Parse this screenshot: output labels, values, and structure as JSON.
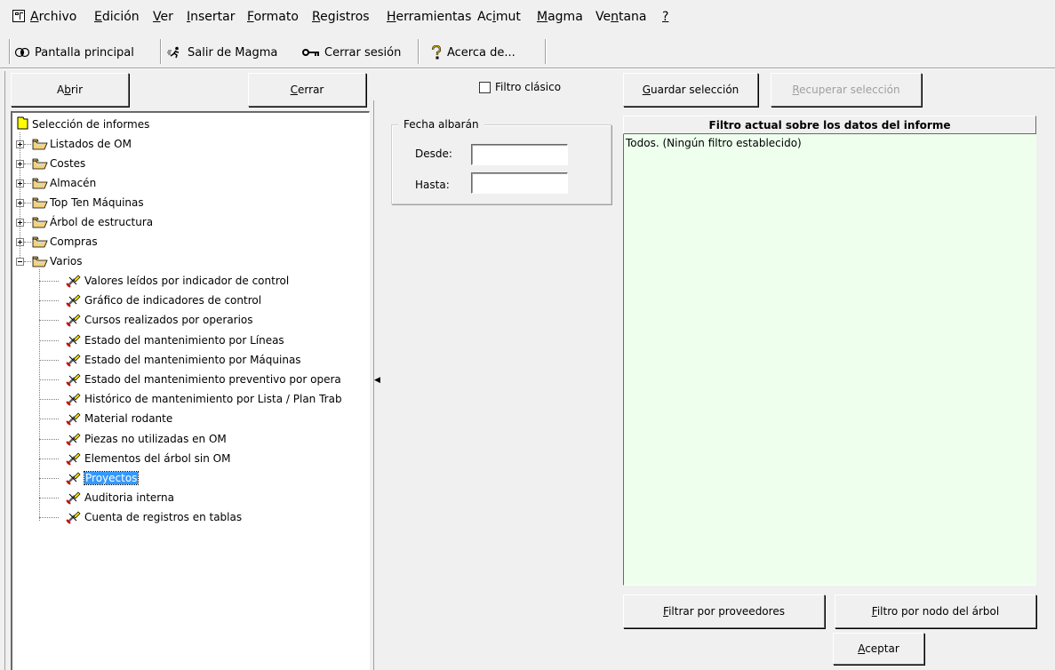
{
  "menu": {
    "items": [
      {
        "label": "Archivo",
        "key": "A"
      },
      {
        "label": "Edición",
        "key": "E"
      },
      {
        "label": "Ver",
        "key": "V"
      },
      {
        "label": "Insertar",
        "key": "I"
      },
      {
        "label": "Formato",
        "key": "F"
      },
      {
        "label": "Registros",
        "key": "R"
      },
      {
        "label": "Herramientas",
        "key": "H"
      },
      {
        "label": "Acimut",
        "key": "i"
      },
      {
        "label": "Magma",
        "key": "M"
      },
      {
        "label": "Ventana",
        "key": "n"
      },
      {
        "label": "?",
        "key": "?"
      }
    ]
  },
  "toolbar": {
    "home_label": "Pantalla principal",
    "exit_label": "Salir de Magma",
    "logout_label": "Cerrar sesión",
    "about_label": "Acerca de..."
  },
  "buttons": {
    "open": "Abrir",
    "close": "Cerrar",
    "save_selection": "Guardar selección",
    "recover_selection": "Recuperar selección",
    "filter_suppliers": "Filtrar por proveedores",
    "filter_tree_node": "Filtro por nodo del árbol",
    "accept": "Aceptar"
  },
  "classic_filter": {
    "label": "Filtro clásico",
    "checked": false
  },
  "tree": {
    "root": "Selección de informes",
    "folders": [
      "Listados de OM",
      "Costes",
      "Almacén",
      "Top Ten Máquinas",
      "Árbol de estructura",
      "Compras",
      "Varios"
    ],
    "varios_items": [
      "Valores leídos por indicador de control",
      "Gráfico de indicadores de control",
      "Cursos realizados por operarios",
      "Estado del mantenimiento por Líneas",
      "Estado del mantenimiento por Máquinas",
      "Estado del mantenimiento preventivo por opera",
      "Histórico de mantenimiento por Lista / Plan Trab",
      "Material rodante",
      "Piezas no utilizadas en OM",
      "Elementos del árbol sin OM",
      "Proyectos",
      "Auditoria interna",
      "Cuenta de registros en tablas"
    ],
    "selected": "Proyectos"
  },
  "date_group": {
    "title": "Fecha albarán",
    "from_label": "Desde:",
    "to_label": "Hasta:",
    "from_value": "",
    "to_value": ""
  },
  "filter_panel": {
    "header": "Filtro actual sobre los datos del informe",
    "text": "Todos. (Ningún filtro establecido)"
  }
}
